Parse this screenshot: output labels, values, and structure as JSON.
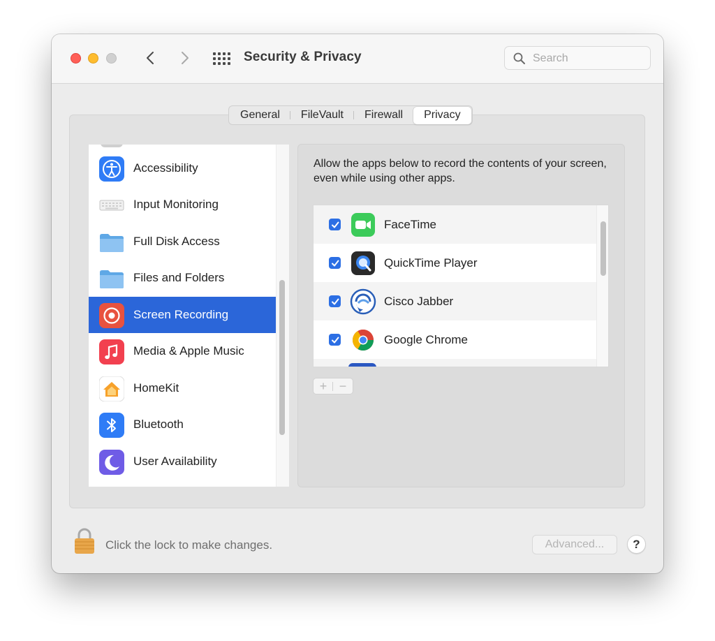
{
  "window": {
    "title": "Security & Privacy",
    "search_placeholder": "Search"
  },
  "tabs": [
    {
      "label": "General"
    },
    {
      "label": "FileVault"
    },
    {
      "label": "Firewall"
    },
    {
      "label": "Privacy",
      "active": true
    }
  ],
  "sidebar": {
    "selected": "Screen Recording",
    "items": [
      {
        "label": "Accessibility",
        "icon": "accessibility-icon"
      },
      {
        "label": "Input Monitoring",
        "icon": "keyboard-icon"
      },
      {
        "label": "Full Disk Access",
        "icon": "folder-icon"
      },
      {
        "label": "Files and Folders",
        "icon": "folder-icon"
      },
      {
        "label": "Screen Recording",
        "icon": "screen-recording-icon"
      },
      {
        "label": "Media & Apple Music",
        "icon": "music-icon"
      },
      {
        "label": "HomeKit",
        "icon": "home-icon"
      },
      {
        "label": "Bluetooth",
        "icon": "bluetooth-icon"
      },
      {
        "label": "User Availability",
        "icon": "moon-icon"
      }
    ]
  },
  "main": {
    "description": "Allow the apps below to record the contents of your screen, even while using other apps.",
    "apps": [
      {
        "name": "FaceTime",
        "checked": true,
        "icon": "facetime-icon"
      },
      {
        "name": "QuickTime Player",
        "checked": true,
        "icon": "quicktime-icon"
      },
      {
        "name": "Cisco Jabber",
        "checked": true,
        "icon": "cisco-jabber-icon"
      },
      {
        "name": "Google Chrome",
        "checked": true,
        "icon": "chrome-icon"
      }
    ],
    "add_label": "+",
    "remove_label": "−"
  },
  "footer": {
    "lock_text": "Click the lock to make changes.",
    "advanced_label": "Advanced...",
    "help_label": "?"
  },
  "colors": {
    "selection": "#2b66d9",
    "checkbox": "#2c6fe4",
    "close": "#ff5f57",
    "minimize": "#febc2e"
  }
}
